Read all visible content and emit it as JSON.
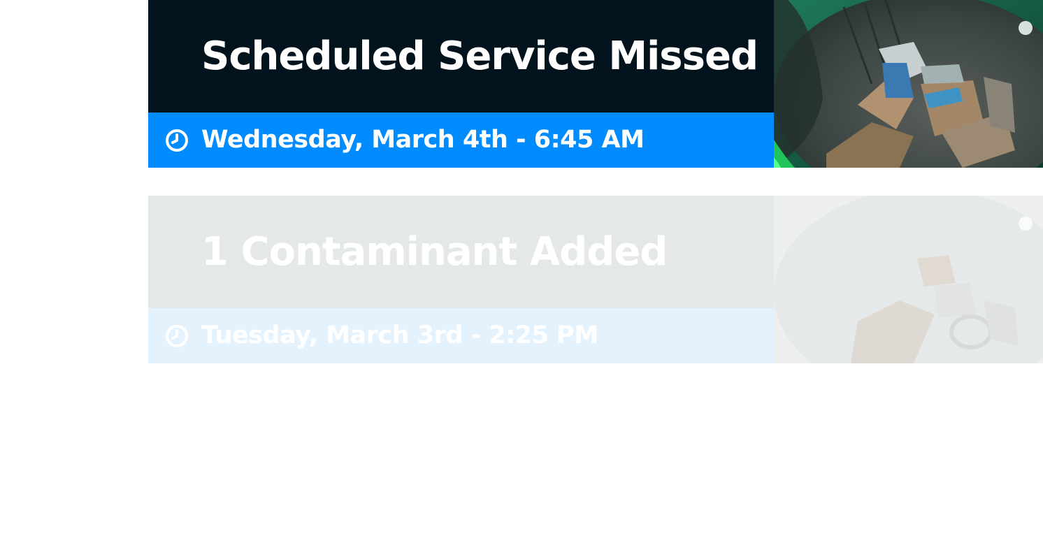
{
  "feed": {
    "events": [
      {
        "title": "Scheduled Service Missed",
        "timestamp": "Wednesday, March 4th - 6:45 AM",
        "time_icon": "clock-icon",
        "state": "active"
      },
      {
        "title": "1 Contaminant Added",
        "timestamp": "Tuesday, March 3rd - 2:25 PM",
        "time_icon": "clock-icon",
        "state": "faded"
      }
    ]
  },
  "colors": {
    "active_header_bg": "#02131d",
    "active_time_bg": "#008cff",
    "faded_header_bg": "#e4e8e9",
    "faded_time_bg": "#e4f2fd",
    "text_light": "#ffffff"
  }
}
